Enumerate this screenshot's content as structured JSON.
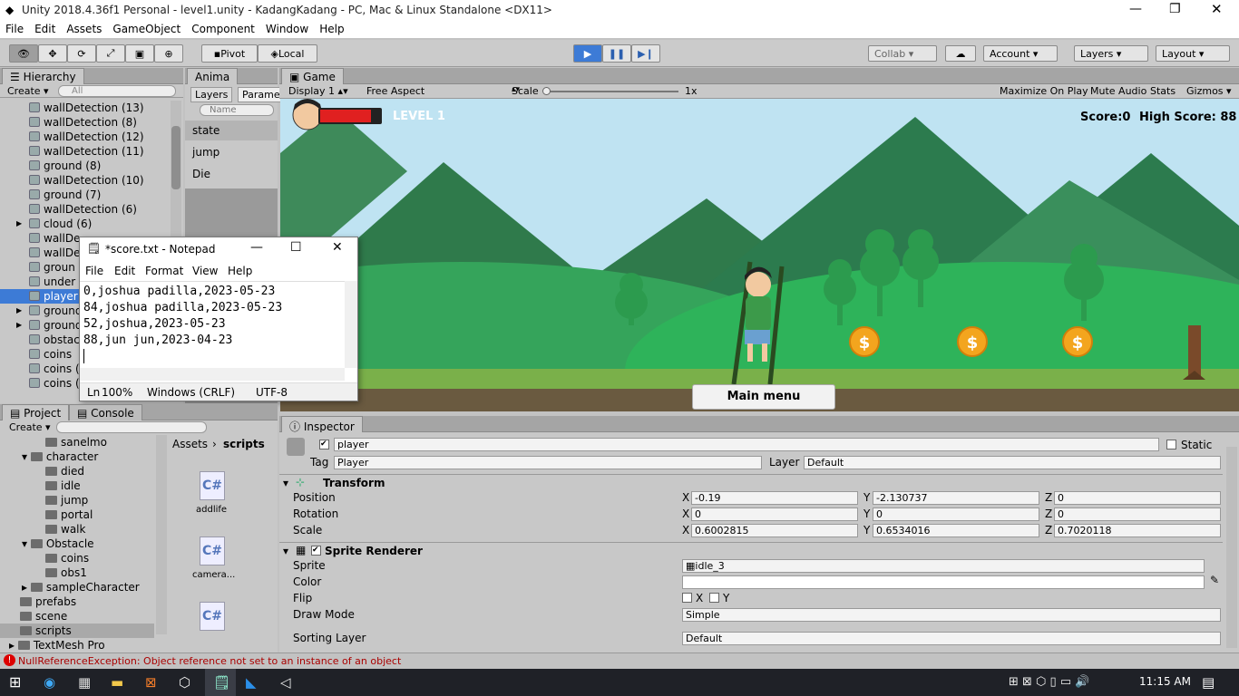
{
  "window": {
    "title": "Unity 2018.4.36f1 Personal - level1.unity - KadangKadang - PC, Mac & Linux Standalone <DX11>"
  },
  "menu": [
    "File",
    "Edit",
    "Assets",
    "GameObject",
    "Component",
    "Window",
    "Help"
  ],
  "toolbar": {
    "pivot": "Pivot",
    "local": "Local",
    "collab": "Collab",
    "account": "Account",
    "layers": "Layers",
    "layout": "Layout"
  },
  "hierarchy": {
    "tab": "Hierarchy",
    "create": "Create",
    "search": "All",
    "items": [
      "wallDetection (13)",
      "wallDetection (8)",
      "wallDetection (12)",
      "wallDetection (11)",
      "ground (8)",
      "wallDetection (10)",
      "ground (7)",
      "wallDetection (6)",
      "cloud (6)",
      "wallDe",
      "wallDe",
      "groun",
      "under",
      "player",
      "ground",
      "ground",
      "obstac",
      "coins",
      "coins (",
      "coins ("
    ]
  },
  "animator": {
    "tab": "Anima",
    "layers": "Layers",
    "params": "Parame",
    "search": "Name",
    "params_list": [
      "state",
      "jump",
      "Die"
    ]
  },
  "game": {
    "tab": "Game",
    "display": "Display 1",
    "aspect": "Free Aspect",
    "scale_label": "Scale",
    "scale_value": "1x",
    "maximize": "Maximize On Play",
    "mute": "Mute Audio",
    "stats": "Stats",
    "gizmos": "Gizmos",
    "level": "LEVEL 1",
    "score": "Score:0",
    "highscore": "High Score: 88",
    "main_menu": "Main menu",
    "health": 0.85
  },
  "notepad": {
    "title": "*score.txt - Notepad",
    "menu": [
      "File",
      "Edit",
      "Format",
      "View",
      "Help"
    ],
    "lines": [
      "0,joshua padilla,2023-05-23",
      "84,joshua padilla,2023-05-23",
      "52,joshua,2023-05-23",
      "88,jun jun,2023-04-23"
    ],
    "status": {
      "ln": "Ln",
      "zoom": "100%",
      "eol": "Windows (CRLF)",
      "enc": "UTF-8"
    }
  },
  "project": {
    "tab": "Project",
    "console": "Console",
    "create": "Create",
    "tree": [
      {
        "t": "sanelmo",
        "d": 3
      },
      {
        "t": "character",
        "d": 2
      },
      {
        "t": "died",
        "d": 3
      },
      {
        "t": "idle",
        "d": 3
      },
      {
        "t": "jump",
        "d": 3
      },
      {
        "t": "portal",
        "d": 3
      },
      {
        "t": "walk",
        "d": 3
      },
      {
        "t": "Obstacle",
        "d": 2
      },
      {
        "t": "coins",
        "d": 3
      },
      {
        "t": "obs1",
        "d": 3
      },
      {
        "t": "sampleCharacter",
        "d": 2
      },
      {
        "t": "prefabs",
        "d": 1
      },
      {
        "t": "scene",
        "d": 1
      },
      {
        "t": "scripts",
        "d": 1
      },
      {
        "t": "TextMesh Pro",
        "d": 1
      }
    ],
    "breadcrumb_root": "Assets",
    "breadcrumb_cur": "scripts",
    "files": [
      "addlife",
      "camera...",
      ""
    ]
  },
  "inspector": {
    "tab": "Inspector",
    "name": "player",
    "static": "Static",
    "tag_label": "Tag",
    "tag": "Player",
    "layer_label": "Layer",
    "layer": "Default",
    "transform": {
      "title": "Transform",
      "position": {
        "label": "Position",
        "x": "-0.19",
        "y": "-2.130737",
        "z": "0"
      },
      "rotation": {
        "label": "Rotation",
        "x": "0",
        "y": "0",
        "z": "0"
      },
      "scale": {
        "label": "Scale",
        "x": "0.6002815",
        "y": "0.6534016",
        "z": "0.7020118"
      }
    },
    "sprite_renderer": {
      "title": "Sprite Renderer",
      "sprite_label": "Sprite",
      "sprite": "idle_3",
      "color_label": "Color",
      "flip_label": "Flip",
      "flip_x": "X",
      "flip_y": "Y",
      "draw_label": "Draw Mode",
      "draw": "Simple",
      "sorting_label": "Sorting Layer",
      "sorting": "Default"
    }
  },
  "status": {
    "error": "NullReferenceException: Object reference not set to an instance of an object"
  },
  "taskbar": {
    "time": "11:15 AM"
  },
  "colors": {
    "play_active": "#3d7bd6",
    "game_sky": "#bfe3f2",
    "grass": "#2eb35a"
  }
}
